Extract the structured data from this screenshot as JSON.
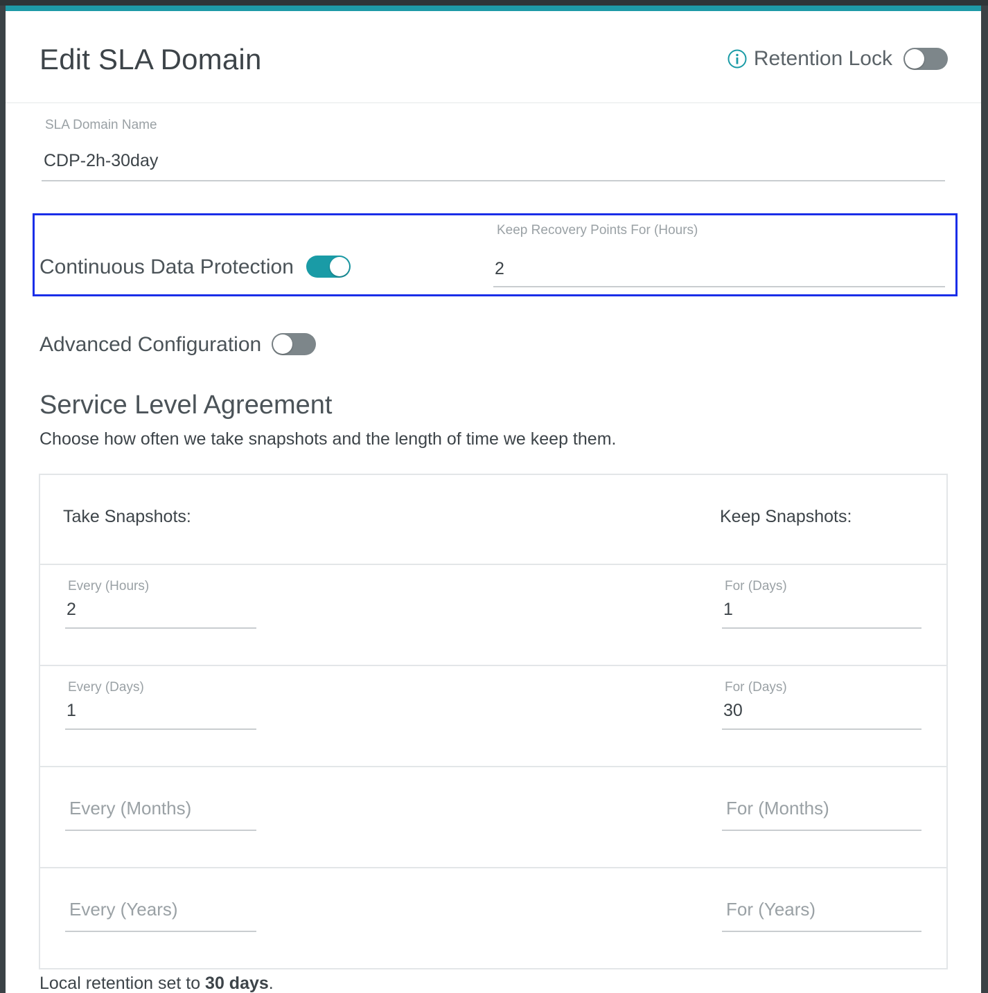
{
  "header": {
    "title": "Edit SLA Domain",
    "retention_lock_label": "Retention Lock",
    "retention_lock_on": false
  },
  "sla_name": {
    "label": "SLA Domain Name",
    "value": "CDP-2h-30day"
  },
  "cdp": {
    "label": "Continuous Data Protection",
    "enabled": true,
    "keep_label": "Keep Recovery Points For (Hours)",
    "keep_value": "2"
  },
  "advanced": {
    "label": "Advanced Configuration",
    "enabled": false
  },
  "sla": {
    "title": "Service Level Agreement",
    "description": "Choose how often we take snapshots and the length of time we keep them.",
    "take_header": "Take Snapshots:",
    "keep_header": "Keep Snapshots:",
    "rows": [
      {
        "take_label": "Every (Hours)",
        "take_value": "2",
        "keep_label": "For (Days)",
        "keep_value": "1"
      },
      {
        "take_label": "Every (Days)",
        "take_value": "1",
        "keep_label": "For (Days)",
        "keep_value": "30"
      },
      {
        "take_placeholder": "Every (Months)",
        "keep_placeholder": "For (Months)"
      },
      {
        "take_placeholder": "Every (Years)",
        "keep_placeholder": "For (Years)"
      }
    ]
  },
  "footer": {
    "prefix": "Local retention set to ",
    "value": "30 days",
    "suffix": "."
  },
  "colors": {
    "accent": "#1a9ba6",
    "highlight_border": "#1a2ee8"
  },
  "icons": {
    "info": "info-icon"
  }
}
